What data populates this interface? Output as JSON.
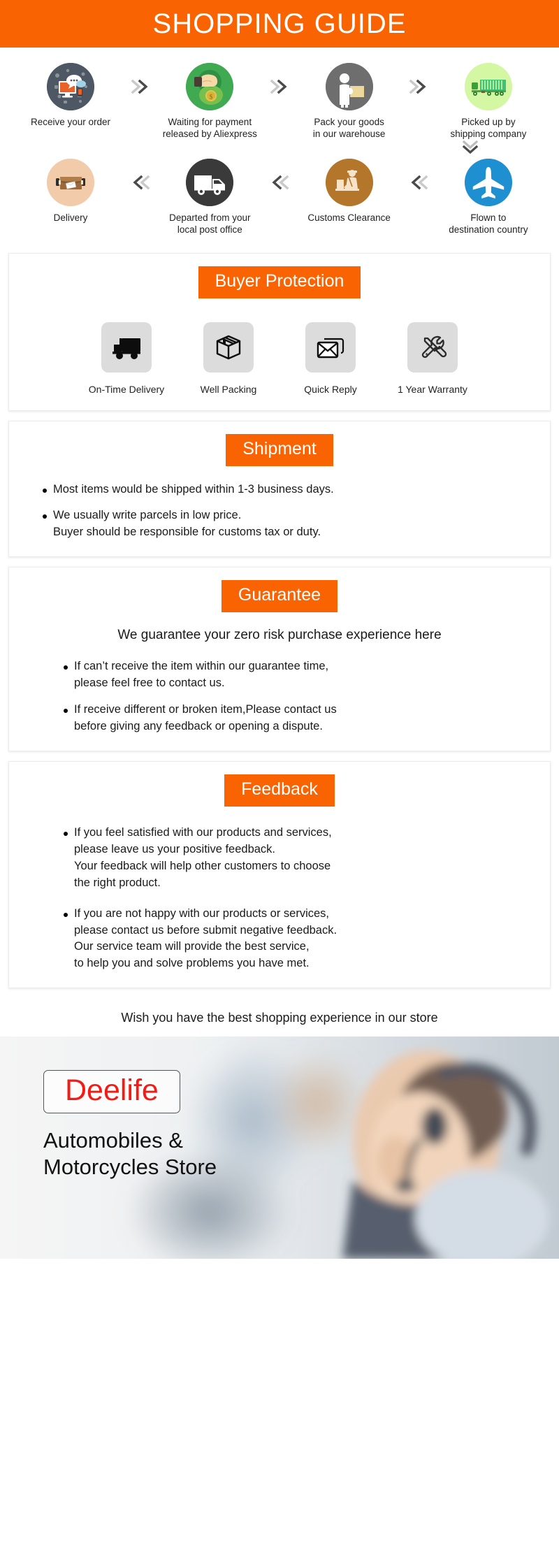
{
  "header": {
    "title": "SHOPPING GUIDE"
  },
  "flow": {
    "row1": [
      {
        "label": "Receive your order",
        "icon": "computer-chat-icon",
        "bg": "#4e5864"
      },
      {
        "label": "Waiting for payment\nreleased by Aliexpress",
        "icon": "money-hand-icon",
        "bg": "#3faa52"
      },
      {
        "label": "Pack your goods\nin our warehouse",
        "icon": "worker-package-icon",
        "bg": "#6e6e6e"
      },
      {
        "label": "Picked up by\nshipping company",
        "icon": "cargo-truck-icon",
        "bg": "#d4f7a3"
      }
    ],
    "row2": [
      {
        "label": "Delivery",
        "icon": "open-parcel-icon",
        "bg": "#f2cbab"
      },
      {
        "label": "Departed from your\nlocal post office",
        "icon": "delivery-van-icon",
        "bg": "#3a3a3a"
      },
      {
        "label": "Customs Clearance",
        "icon": "customs-officer-icon",
        "bg": "#b4762a"
      },
      {
        "label": "Flown to\ndestination country",
        "icon": "airplane-icon",
        "bg": "#1e8fd1"
      }
    ]
  },
  "protection": {
    "badge": "Buyer Protection",
    "items": [
      {
        "label": "On-Time Delivery",
        "icon": "truck-icon"
      },
      {
        "label": "Well Packing",
        "icon": "box-icon"
      },
      {
        "label": "Quick Reply",
        "icon": "envelope-icon"
      },
      {
        "label": "1 Year Warranty",
        "icon": "tools-icon"
      }
    ]
  },
  "shipment": {
    "badge": "Shipment",
    "bullets": [
      "Most items would be shipped within 1-3 business days.",
      "We usually write parcels in low price.\nBuyer should be responsible for customs tax or duty."
    ]
  },
  "guarantee": {
    "badge": "Guarantee",
    "lead": "We guarantee your zero risk purchase experience here",
    "bullets": [
      "If can’t receive the item within our guarantee time,\nplease feel free to contact us.",
      "If receive different or broken item,Please contact us\nbefore giving any feedback or opening a dispute."
    ]
  },
  "feedback": {
    "badge": "Feedback",
    "bullets": [
      "If you feel satisfied with our products and services,\nplease leave us your positive feedback.\nYour feedback will help other customers to choose\nthe right product.",
      "If you are not happy with our products or services,\nplease contact us before submit negative feedback.\nOur service team will provide the best service,\nto help you and solve problems you have met."
    ]
  },
  "closing": "Wish you have the best shopping experience in our store",
  "footer": {
    "logo": "Deelife",
    "store_name": "Automobiles &\nMotorcycles Store"
  },
  "colors": {
    "brand_orange": "#f96302",
    "logo_red": "#f41b14",
    "icon_tile": "#dcdcdc"
  }
}
